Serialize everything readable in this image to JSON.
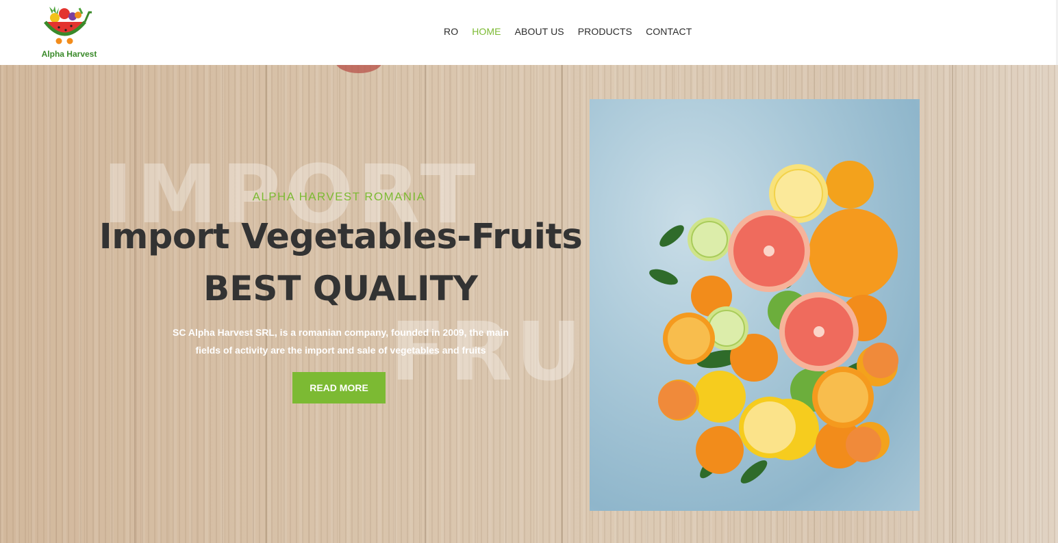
{
  "brand": {
    "name": "Alpha Harvest"
  },
  "nav": {
    "items": [
      {
        "label": "RO",
        "active": false
      },
      {
        "label": "HOME",
        "active": true
      },
      {
        "label": "ABOUT US",
        "active": false
      },
      {
        "label": "PRODUCTS",
        "active": false
      },
      {
        "label": "CONTACT",
        "active": false
      }
    ]
  },
  "hero": {
    "ghost_word_1": "IMPORT",
    "ghost_word_2": "FRU",
    "eyebrow": "ALPHA HARVEST ROMANIA",
    "title": "Import Vegetables-Fruits",
    "subtitle": "BEST QUALITY",
    "description": "SC Alpha Harvest SRL, is a romanian company, founded in 2009, the main fields of activity are the import and sale of vegetables and fruits",
    "button_label": "READ MORE"
  },
  "colors": {
    "accent": "#7cba33",
    "heading": "#333333",
    "logo_text": "#3a8a2a"
  }
}
